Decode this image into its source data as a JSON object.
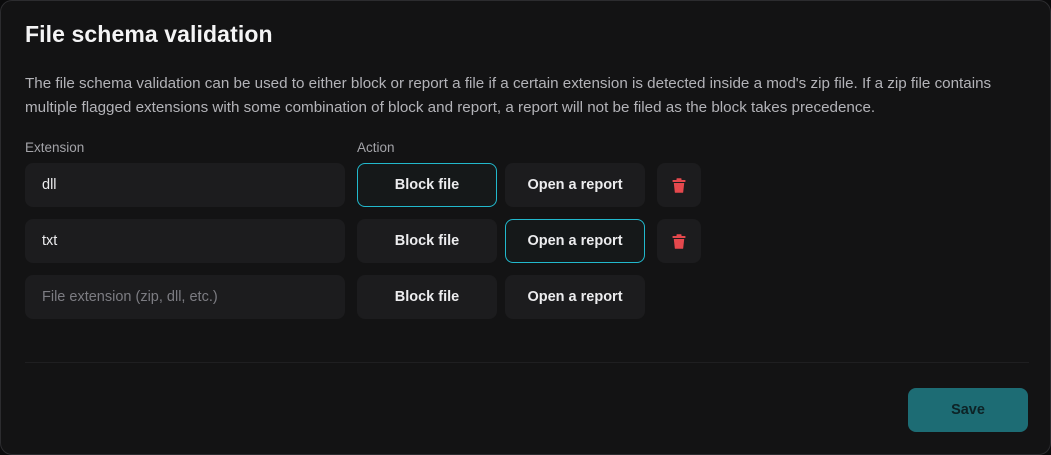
{
  "title": "File schema validation",
  "description": "The file schema validation can be used to either block or report a file if a certain extension is detected inside a mod's zip file. If a zip file contains multiple flagged extensions with some combination of block and report, a report will not be filed as the block takes precedence.",
  "columns": {
    "extension": "Extension",
    "action": "Action"
  },
  "rows": [
    {
      "extension": "dll",
      "selected_action": "block"
    },
    {
      "extension": "txt",
      "selected_action": "report"
    }
  ],
  "new_row": {
    "extension": "",
    "placeholder": "File extension (zip, dll, etc.)"
  },
  "buttons": {
    "block_label": "Block file",
    "report_label": "Open a report",
    "save_label": "Save",
    "delete_icon": "trash-icon"
  },
  "colors": {
    "selected_border": "#22b8cc",
    "save_background": "#1d6c74",
    "delete_icon": "#e5484d"
  }
}
